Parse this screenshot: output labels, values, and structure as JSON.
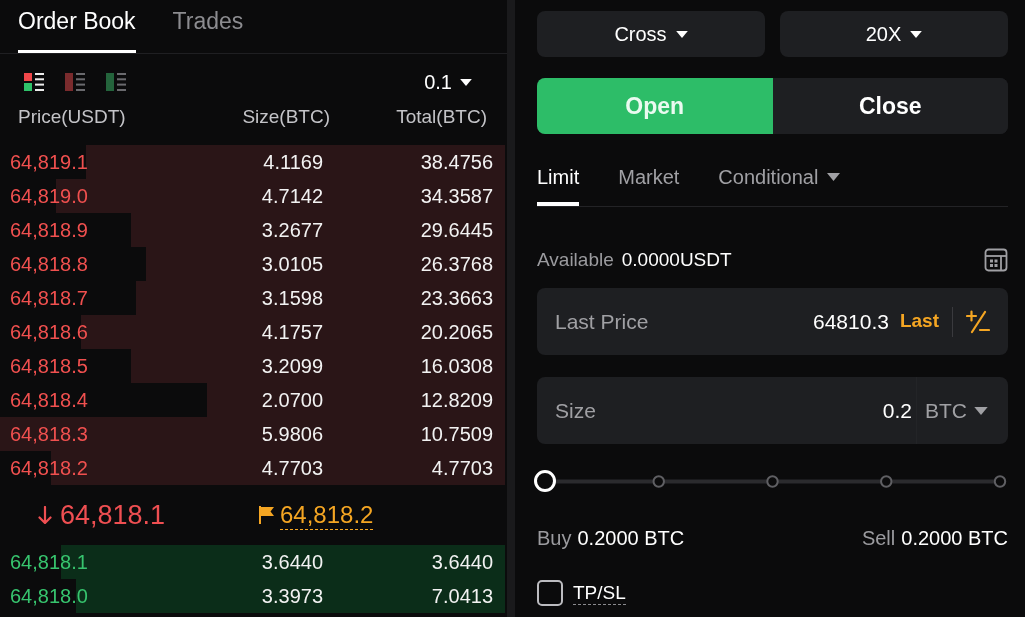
{
  "order_book": {
    "tabs": [
      {
        "label": "Order Book",
        "selected": true
      },
      {
        "label": "Trades",
        "selected": false
      }
    ],
    "layout_modes": [
      {
        "kind": "both",
        "selected": true
      },
      {
        "kind": "asks",
        "selected": false
      },
      {
        "kind": "bids",
        "selected": false
      }
    ],
    "precision": "0.1",
    "columns": [
      "Price(USDT)",
      "Size(BTC)",
      "Total(BTC)"
    ],
    "asks": [
      {
        "price": "64,819.1",
        "size": "4.1169",
        "total": "38.4756",
        "level": 0.83
      },
      {
        "price": "64,819.0",
        "size": "4.7142",
        "total": "34.3587",
        "level": 0.89
      },
      {
        "price": "64,818.9",
        "size": "3.2677",
        "total": "29.6445",
        "level": 0.74
      },
      {
        "price": "64,818.8",
        "size": "3.0105",
        "total": "26.3768",
        "level": 0.71
      },
      {
        "price": "64,818.7",
        "size": "3.1598",
        "total": "23.3663",
        "level": 0.73
      },
      {
        "price": "64,818.6",
        "size": "4.1757",
        "total": "20.2065",
        "level": 0.84
      },
      {
        "price": "64,818.5",
        "size": "3.2099",
        "total": "16.0308",
        "level": 0.74
      },
      {
        "price": "64,818.4",
        "size": "2.0700",
        "total": "12.8209",
        "level": 0.59
      },
      {
        "price": "64,818.3",
        "size": "5.9806",
        "total": "10.7509",
        "level": 1
      },
      {
        "price": "64,818.2",
        "size": "4.7703",
        "total": "4.7703",
        "level": 0.9
      }
    ],
    "last_price": {
      "falling": true,
      "value": "64,818.1"
    },
    "mark_price": "64,818.2",
    "bids": [
      {
        "price": "64,818.1",
        "size": "3.6440",
        "total": "3.6440",
        "level": 0.88
      },
      {
        "price": "64,818.0",
        "size": "3.3973",
        "total": "7.0413",
        "level": 0.85
      }
    ]
  },
  "order_form": {
    "margin_mode": "Cross",
    "leverage": "20X",
    "sides": [
      {
        "label": "Open",
        "selected": true
      },
      {
        "label": "Close",
        "selected": false
      }
    ],
    "order_types": [
      {
        "label": "Limit",
        "selected": true,
        "dropdown": false
      },
      {
        "label": "Market",
        "selected": false,
        "dropdown": false
      },
      {
        "label": "Conditional",
        "selected": false,
        "dropdown": true
      }
    ],
    "available": {
      "label": "Available",
      "value": "0.0000USDT"
    },
    "price_field": {
      "label": "Last Price",
      "value": "64810.3",
      "tag": "Last"
    },
    "size_field": {
      "label": "Size",
      "value": "0.2",
      "unit": "BTC"
    },
    "slider": {
      "level": 0
    },
    "max_buy": {
      "label": "Buy",
      "value": "0.2000 BTC"
    },
    "max_sell": {
      "label": "Sell",
      "value": "0.2000 BTC"
    },
    "tp_sl": {
      "label": "TP/SL",
      "checked": false
    }
  }
}
